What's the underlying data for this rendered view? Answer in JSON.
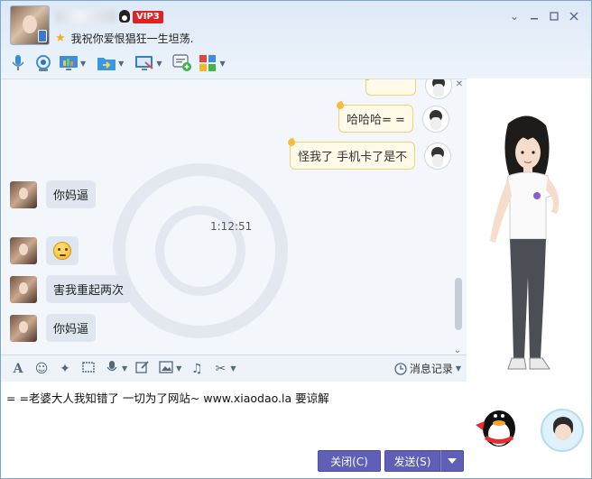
{
  "header": {
    "vip_label": "VIP3",
    "signature": "我祝你爱恨猖狂一生坦荡."
  },
  "window_controls": [
    "chevron-down",
    "minimize",
    "maximize",
    "close"
  ],
  "toolbar": {
    "tools": [
      "mic-icon",
      "video-call-icon",
      "screen-share-icon",
      "file-transfer-icon",
      "remote-desktop-icon",
      "new-chat-icon",
      "apps-icon"
    ]
  },
  "chat": {
    "messages": [
      {
        "side": "out",
        "text": "哈哈哈= ="
      },
      {
        "side": "out",
        "text": "怪我了 手机卡了是不"
      },
      {
        "side": "in",
        "text": "你妈逼"
      },
      {
        "side": "in",
        "text": "emoji"
      },
      {
        "side": "in",
        "text": "害我重起两次"
      },
      {
        "side": "in",
        "text": "你妈逼"
      }
    ],
    "timestamp": "1:12:51"
  },
  "input": {
    "text": "=  =老婆大人我知错了 一切为了网站~ www.xiaodao.la 要谅解",
    "history_label": "消息记录"
  },
  "buttons": {
    "close": "关闭(C)",
    "send": "发送(S)"
  }
}
